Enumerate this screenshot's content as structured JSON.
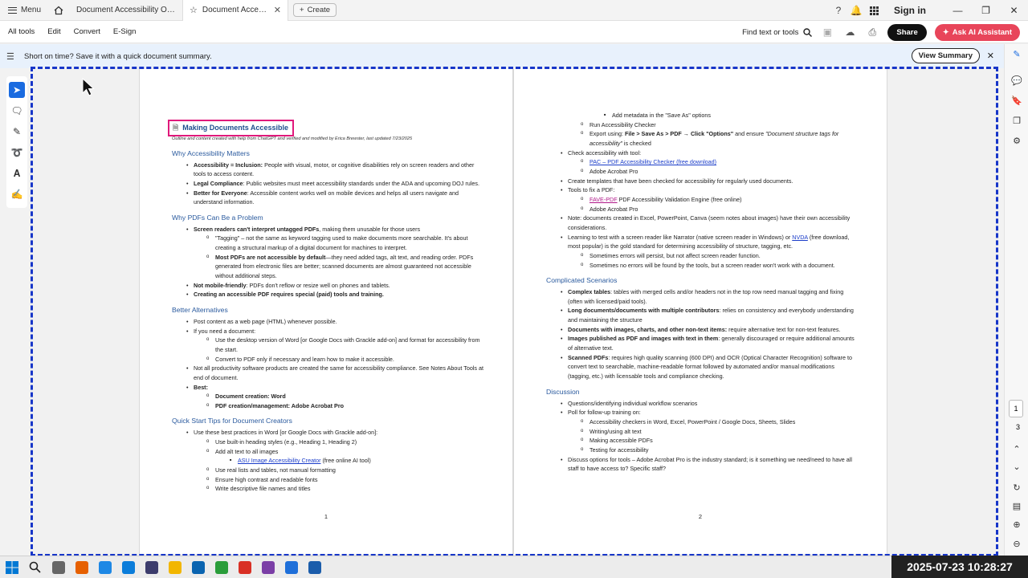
{
  "tabbar": {
    "menu_label": "Menu",
    "tab1_label": "Document Accessibility Overvie...",
    "tab2_label": "Document Accessibility ...",
    "create_label": "Create",
    "signin_label": "Sign in"
  },
  "toolbar": {
    "items": [
      "All tools",
      "Edit",
      "Convert",
      "E-Sign"
    ],
    "find_label": "Find text or tools",
    "share_label": "Share",
    "ai_label": "Ask AI Assistant"
  },
  "banner": {
    "text": "Short on time? Save it with a quick document summary.",
    "button_label": "View Summary"
  },
  "right_rail": {
    "page_current": "1",
    "page_total": "3"
  },
  "page1": {
    "title": "Making Documents Accessible",
    "subtitle": "Outline and content created with help from ChatGPT and verified and modified by Erica Brewster, last updated 7/23/2025",
    "number": "1",
    "sec1": {
      "heading": "Why Accessibility Matters",
      "items": [
        {
          "b": "Accessibility = Inclusion:",
          "t": " People with visual, motor, or cognitive disabilities rely on screen readers and other tools to access content."
        },
        {
          "b": "Legal Compliance",
          "t": ": Public websites must meet accessibility standards under the ADA and upcoming DOJ rules."
        },
        {
          "b": "Better for Everyone",
          "t": ": Accessible content works well on mobile devices and helps all users navigate and understand information."
        }
      ]
    },
    "sec2": {
      "heading": "Why PDFs Can Be a Problem",
      "i1b": "Screen readers can't interpret untagged PDFs",
      "i1t": ", making them unusable for those users",
      "i1a": "\"Tagging\" – not the same as keyword tagging used to make documents more searchable. It's about creating a structural markup of a digital document for machines to interpret.",
      "i1bb": "Most PDFs are not accessible by default",
      "i1bt": "—they need added tags, alt text, and reading order. PDFs generated from electronic files are better; scanned documents are almost guaranteed not accessible without additional steps.",
      "i2b": "Not mobile-friendly",
      "i2t": ": PDFs don't reflow or resize well on phones and tablets.",
      "i3b": "Creating an accessible PDF requires special (paid) tools and training."
    },
    "sec3": {
      "heading": "Better Alternatives",
      "i1": "Post content as a web page (HTML) whenever possible.",
      "i2": "If you need a document:",
      "i2a": "Use the desktop version of Word [or Google Docs with Grackle add-on] and format for accessibility from the start.",
      "i2b": "Convert to PDF only if necessary and learn how to make it accessible.",
      "i3": "Not all productivity software products are created the same for accessibility compliance. See Notes About Tools at end of document.",
      "i4": "Best:",
      "i4a": "Document creation: Word",
      "i4b": "PDF creation/management: Adobe Acrobat Pro"
    },
    "sec4": {
      "heading": "Quick Start Tips for Document Creators",
      "i1": "Use these best practices in Word [or Google Docs with Grackle add-on]:",
      "a1": "Use built-in heading styles (e.g., Heading 1, Heading 2)",
      "a2": "Add alt text to all images",
      "a2link": "ASU Image Accessibility Creator",
      "a2t": " (free online AI tool)",
      "a3": "Use real lists and tables, not manual formatting",
      "a4": "Ensure high contrast and readable fonts",
      "a5": "Write descriptive file names and titles"
    }
  },
  "page2": {
    "number": "2",
    "top": {
      "m1": "Add metadata in the \"Save As\" options",
      "m2": "Run Accessibility Checker",
      "m3a": "Export using: ",
      "m3b": "File > Save As > PDF → Click \"Options\"",
      "m3c": " and ensure ",
      "m3d": "\"Document structure tags for accessibility\"",
      "m3e": " is checked",
      "c1": "Check accessibility with tool:",
      "c1a": "PAC – PDF Accessibility Checker (free download)",
      "c1b": "Adobe Acrobat Pro",
      "c2": "Create templates that have been checked for accessibility for regularly used documents.",
      "c3": "Tools to fix a PDF:",
      "c3a_link": "FAVE-PDF",
      "c3a_t": " PDF Accessibility Validation Engine (free online)",
      "c3b": "Adobe Acrobat Pro",
      "c4": "Note: documents created in Excel, PowerPoint, Canva (seem notes about images) have their own accessibility considerations.",
      "c5a": "Learning to test with a screen reader like Narrator (native screen reader in Windows) or ",
      "c5link": "NVDA",
      "c5b": " (free download, most popular) is the gold standard for determining accessibility of structure, tagging, etc.",
      "c5i": "Sometimes errors will persist, but not affect screen reader function.",
      "c5ii": "Sometimes no errors will be found by the tools, but a screen reader won't work with a document."
    },
    "sec5": {
      "heading": "Complicated Scenarios",
      "items": [
        {
          "b": "Complex tables",
          "t": ": tables with merged cells and/or headers not in the top row need manual tagging and fixing (often with licensed/paid tools)."
        },
        {
          "b": "Long documents/documents with multiple contributors",
          "t": ": relies on consistency and everybody understanding and maintaining the structure"
        },
        {
          "b": "Documents with images, charts, and other non-text items:",
          "t": " require alternative text for non-text features."
        },
        {
          "b": "Images published as PDF and images with text in them",
          "t": ": generally discouraged or require additional amounts of alternative text."
        },
        {
          "b": "Scanned PDFs",
          "t": ": requires high quality scanning (600 DPI) and OCR (Optical Character Recognition) software to convert text to searchable, machine-readable format followed by automated and/or manual modifications (tagging, etc.) with licensable tools and compliance checking."
        }
      ]
    },
    "sec6": {
      "heading": "Discussion",
      "i1": "Questions/identifying individual workflow scenarios",
      "i2": "Poll for follow-up training on:",
      "i2a": "Accessibility checkers in Word, Excel, PowerPoint / Google Docs, Sheets, Slides",
      "i2b": "Writing/using alt text",
      "i2c": "Making accessible PDFs",
      "i2d": "Testing for accessibility",
      "i3": "Discuss options for tools – Adobe Acrobat Pro is the industry standard; is it something we need/need to have all staff to have access to? Specific staff?"
    }
  },
  "clock": "2025-07-23  10:28:27",
  "taskbar_colors": [
    "#0078d4",
    "#333333",
    "#666666",
    "#e66000",
    "#1e88e5",
    "#0b7dda",
    "#3c3c6c",
    "#f2b600",
    "#0a64b0",
    "#2a9d3a",
    "#d93025",
    "#7b3fa6",
    "#1e6fd9",
    "#1b5dab",
    "#d4261f",
    "#222222"
  ]
}
